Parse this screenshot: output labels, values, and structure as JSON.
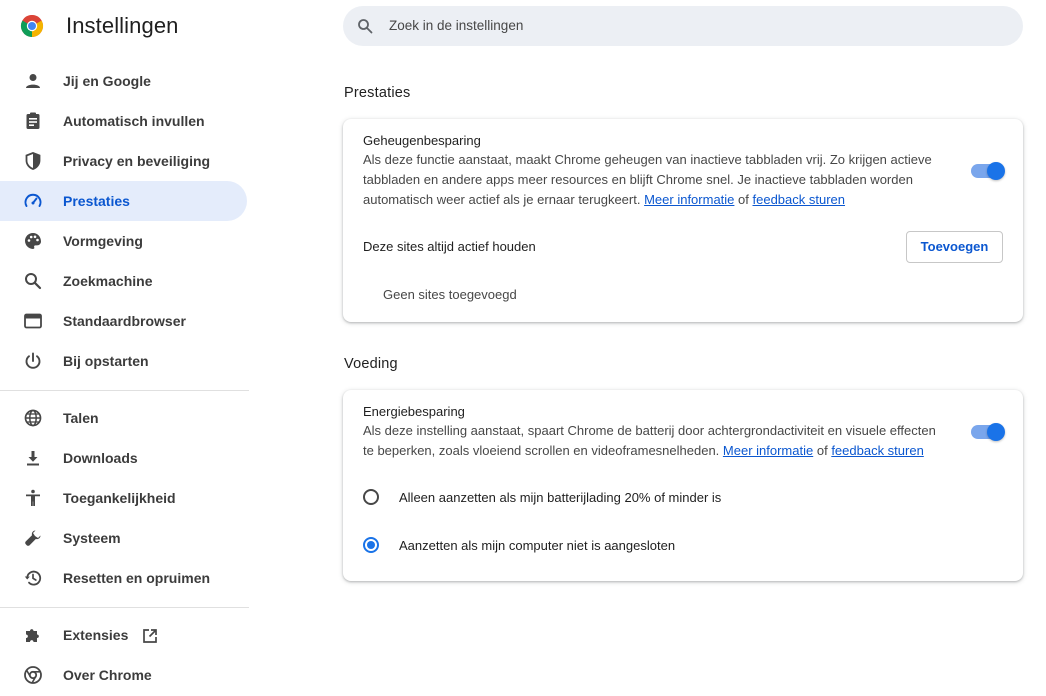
{
  "header": {
    "title": "Instellingen",
    "search_placeholder": "Zoek in de instellingen"
  },
  "sidebar": {
    "items": [
      {
        "label": "Jij en Google",
        "icon": "person-icon"
      },
      {
        "label": "Automatisch invullen",
        "icon": "clipboard-icon"
      },
      {
        "label": "Privacy en beveiliging",
        "icon": "shield-icon"
      },
      {
        "label": "Prestaties",
        "icon": "speedometer-icon",
        "active": true
      },
      {
        "label": "Vormgeving",
        "icon": "palette-icon"
      },
      {
        "label": "Zoekmachine",
        "icon": "search-icon"
      },
      {
        "label": "Standaardbrowser",
        "icon": "browser-window-icon"
      },
      {
        "label": "Bij opstarten",
        "icon": "power-icon"
      },
      {
        "label": "Talen",
        "icon": "globe-icon"
      },
      {
        "label": "Downloads",
        "icon": "download-icon"
      },
      {
        "label": "Toegankelijkheid",
        "icon": "accessibility-icon"
      },
      {
        "label": "Systeem",
        "icon": "wrench-icon"
      },
      {
        "label": "Resetten en opruimen",
        "icon": "history-icon"
      },
      {
        "label": "Extensies",
        "icon": "puzzle-icon",
        "external": "open-external-icon"
      },
      {
        "label": "Over Chrome",
        "icon": "chrome-icon"
      }
    ]
  },
  "performance": {
    "section_title": "Prestaties",
    "memory": {
      "title": "Geheugenbesparing",
      "desc_line1": "Als deze functie aanstaat, maakt Chrome geheugen van inactieve tabbladen vrij. Zo krijgen actieve",
      "desc_line2": "tabbladen en andere apps meer resources en blijft Chrome snel. Je inactieve tabbladen worden",
      "desc_line3": "automatisch weer actief als je ernaar terugkeert.",
      "link_more": "Meer informatie",
      "of": "of",
      "link_feedback": "feedback sturen",
      "enabled": true
    },
    "sites": {
      "title": "Deze sites altijd actief houden",
      "add_button": "Toevoegen",
      "empty": "Geen sites toegevoegd"
    }
  },
  "power": {
    "section_title": "Voeding",
    "energy": {
      "title": "Energiebesparing",
      "desc_line1": "Als deze instelling aanstaat, spaart Chrome de batterij door achtergrondactiviteit en visuele effecten",
      "desc_line2": "te beperken, zoals vloeiend scrollen en videoframesnelheden.",
      "link_more": "Meer informatie",
      "of": "of",
      "link_feedback": "feedback sturen",
      "enabled": true
    },
    "options": [
      {
        "label": "Alleen aanzetten als mijn batterijlading 20% of minder is",
        "checked": false
      },
      {
        "label": "Aanzetten als mijn computer niet is aangesloten",
        "checked": true
      }
    ]
  },
  "colors": {
    "accent": "#1a73e8",
    "link": "#0b57d0",
    "active_nav_bg": "#e4ecfb"
  }
}
